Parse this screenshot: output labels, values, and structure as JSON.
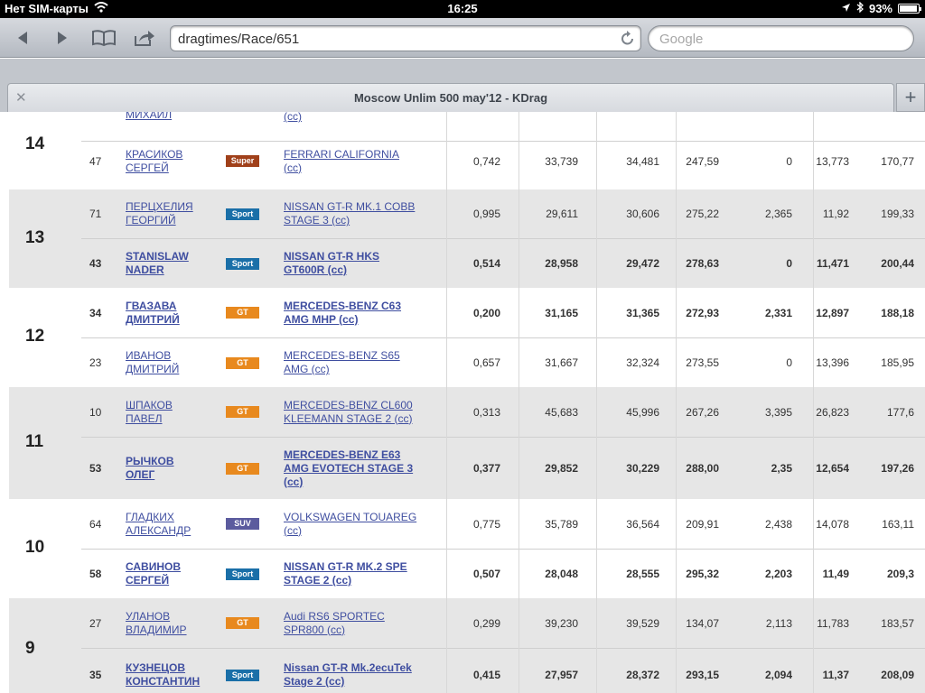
{
  "status": {
    "carrier": "Нет SIM-карты",
    "time": "16:25",
    "battery": "93%"
  },
  "browser": {
    "url": "dragtimes/Race/651",
    "search_placeholder": "Google",
    "tab_title": "Moscow Unlim 500 may'12 - KDrag"
  },
  "badge_colors": {
    "Super": "#a0401a",
    "Sport": "#1a6fa8",
    "GT": "#e8891e",
    "SUV": "#5b5b9e"
  },
  "partial_top": {
    "name": "МИХАИЛ",
    "car": "(cc)"
  },
  "groups": [
    {
      "place": "14",
      "rows": [
        {
          "num": "47",
          "driver": [
            "КРАСИКОВ",
            "СЕРГЕЙ"
          ],
          "class": "Super",
          "car": [
            "FERRARI CALIFORNIA",
            "(cc)"
          ],
          "v1": "0,742",
          "v2": "33,739",
          "v3": "34,481",
          "v4": "247,59",
          "v5": "0",
          "v6": "13,773",
          "v7": "170,77",
          "bold": false
        }
      ]
    },
    {
      "place": "13",
      "rows": [
        {
          "num": "71",
          "driver": [
            "ПЕРЦХЕЛИЯ",
            "ГЕОРГИЙ"
          ],
          "class": "Sport",
          "car": [
            "NISSAN GT-R MK.1 COBB",
            "STAGE 3 (cc)"
          ],
          "v1": "0,995",
          "v2": "29,611",
          "v3": "30,606",
          "v4": "275,22",
          "v5": "2,365",
          "v6": "11,92",
          "v7": "199,33",
          "bold": false
        },
        {
          "num": "43",
          "driver": [
            "STANISLAW",
            "NADER"
          ],
          "class": "Sport",
          "car": [
            "NISSAN GT-R HKS",
            "GT600R (cc)"
          ],
          "v1": "0,514",
          "v2": "28,958",
          "v3": "29,472",
          "v4": "278,63",
          "v5": "0",
          "v6": "11,471",
          "v7": "200,44",
          "bold": true
        }
      ]
    },
    {
      "place": "12",
      "rows": [
        {
          "num": "34",
          "driver": [
            "ГВАЗАВА",
            "ДМИТРИЙ"
          ],
          "class": "GT",
          "car": [
            "MERCEDES-BENZ C63",
            "AMG MHP (cc)"
          ],
          "v1": "0,200",
          "v2": "31,165",
          "v3": "31,365",
          "v4": "272,93",
          "v5": "2,331",
          "v6": "12,897",
          "v7": "188,18",
          "bold": true
        },
        {
          "num": "23",
          "driver": [
            "ИВАНОВ",
            "ДМИТРИЙ"
          ],
          "class": "GT",
          "car": [
            "MERCEDES-BENZ S65",
            "AMG (cc)"
          ],
          "v1": "0,657",
          "v2": "31,667",
          "v3": "32,324",
          "v4": "273,55",
          "v5": "0",
          "v6": "13,396",
          "v7": "185,95",
          "bold": false
        }
      ]
    },
    {
      "place": "11",
      "rows": [
        {
          "num": "10",
          "driver": [
            "ШПАКОВ",
            "ПАВЕЛ"
          ],
          "class": "GT",
          "car": [
            "MERCEDES-BENZ CL600",
            "KLEEMANN STAGE 2 (cc)"
          ],
          "v1": "0,313",
          "v2": "45,683",
          "v3": "45,996",
          "v4": "267,26",
          "v5": "3,395",
          "v6": "26,823",
          "v7": "177,6",
          "bold": false
        },
        {
          "num": "53",
          "driver": [
            "РЫЧКОВ",
            "ОЛЕГ"
          ],
          "class": "GT",
          "car": [
            "MERCEDES-BENZ E63",
            "AMG EVOTECH STAGE 3",
            "(cc)"
          ],
          "v1": "0,377",
          "v2": "29,852",
          "v3": "30,229",
          "v4": "288,00",
          "v5": "2,35",
          "v6": "12,654",
          "v7": "197,26",
          "bold": true
        }
      ]
    },
    {
      "place": "10",
      "rows": [
        {
          "num": "64",
          "driver": [
            "ГЛАДКИХ",
            "АЛЕКСАНДР"
          ],
          "class": "SUV",
          "car": [
            "VOLKSWAGEN TOUAREG",
            "(cc)"
          ],
          "v1": "0,775",
          "v2": "35,789",
          "v3": "36,564",
          "v4": "209,91",
          "v5": "2,438",
          "v6": "14,078",
          "v7": "163,11",
          "bold": false
        },
        {
          "num": "58",
          "driver": [
            "САВИНОВ",
            "СЕРГЕЙ"
          ],
          "class": "Sport",
          "car": [
            "NISSAN GT-R MK.2 SPE",
            "STAGE 2 (cc)"
          ],
          "v1": "0,507",
          "v2": "28,048",
          "v3": "28,555",
          "v4": "295,32",
          "v5": "2,203",
          "v6": "11,49",
          "v7": "209,3",
          "bold": true
        }
      ]
    },
    {
      "place": "9",
      "rows": [
        {
          "num": "27",
          "driver": [
            "УЛАНОВ",
            "ВЛАДИМИР"
          ],
          "class": "GT",
          "car": [
            "Audi RS6 SPORTEC",
            "SPR800 (cc)"
          ],
          "v1": "0,299",
          "v2": "39,230",
          "v3": "39,529",
          "v4": "134,07",
          "v5": "2,113",
          "v6": "11,783",
          "v7": "183,57",
          "bold": false
        },
        {
          "num": "35",
          "driver": [
            "КУЗНЕЦОВ",
            "КОНСТАНТИН"
          ],
          "class": "Sport",
          "car": [
            "Nissan GT-R Mk.2ecuTek",
            "Stage 2 (cc)"
          ],
          "v1": "0,415",
          "v2": "27,957",
          "v3": "28,372",
          "v4": "293,15",
          "v5": "2,094",
          "v6": "11,37",
          "v7": "208,09",
          "bold": true
        }
      ]
    }
  ]
}
